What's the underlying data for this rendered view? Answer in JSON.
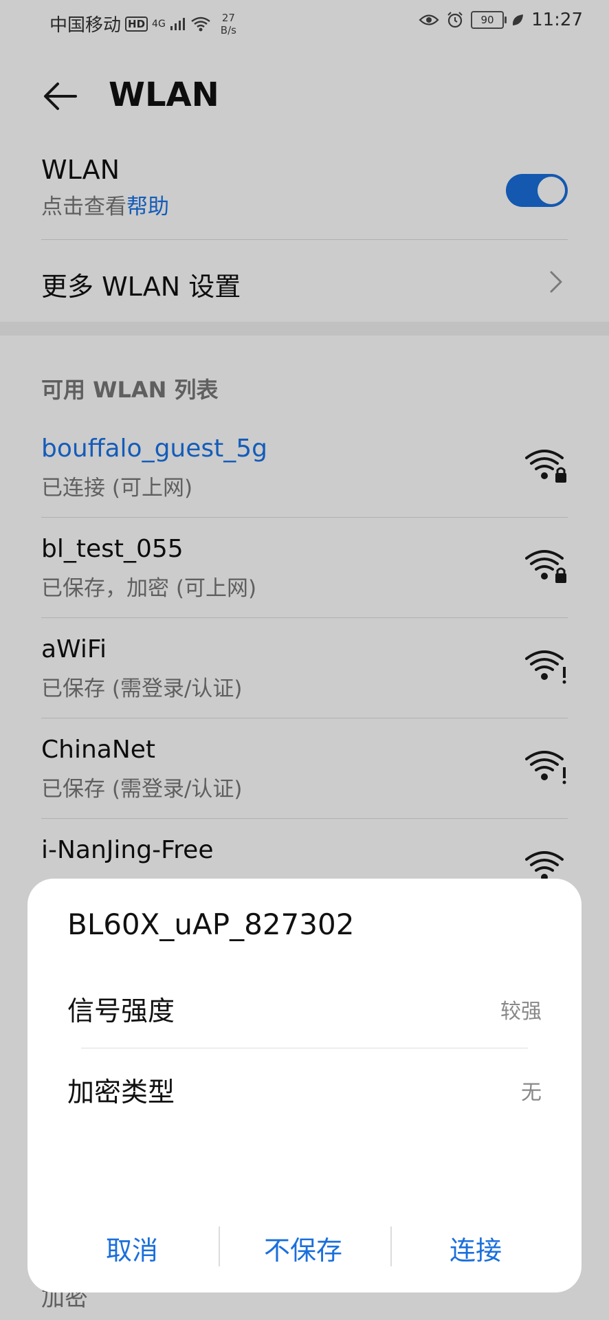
{
  "status_bar": {
    "carrier": "中国移动",
    "hd": "HD",
    "network": "4G",
    "speed_value": "27",
    "speed_unit": "B/s",
    "battery": "90",
    "time": "11:27"
  },
  "header": {
    "title": "WLAN"
  },
  "wlan_toggle": {
    "title": "WLAN",
    "subtitle_prefix": "点击查看",
    "help_link": "帮助",
    "enabled": true
  },
  "more_settings": {
    "label": "更多 WLAN 设置"
  },
  "available_section": {
    "title": "可用 WLAN 列表"
  },
  "networks": [
    {
      "name": "bouffalo_guest_5g",
      "status": "已连接 (可上网)",
      "icon": "wifi-lock-icon",
      "connected": true
    },
    {
      "name": "bl_test_055",
      "status": "已保存，加密 (可上网)",
      "icon": "wifi-lock-icon",
      "connected": false
    },
    {
      "name": "aWiFi",
      "status": "已保存 (需登录/认证)",
      "icon": "wifi-alert-icon",
      "connected": false
    },
    {
      "name": "ChinaNet",
      "status": "已保存 (需登录/认证)",
      "icon": "wifi-alert-icon",
      "connected": false
    },
    {
      "name": "i-NanJing-Free",
      "status": "",
      "icon": "wifi-alert-icon",
      "connected": false
    }
  ],
  "bottom_peek": "加密",
  "dialog": {
    "title": "BL60X_uAP_827302",
    "rows": [
      {
        "label": "信号强度",
        "value": "较强"
      },
      {
        "label": "加密类型",
        "value": "无"
      }
    ],
    "actions": {
      "cancel": "取消",
      "forget": "不保存",
      "connect": "连接"
    }
  },
  "colors": {
    "accent": "#1a6fdc",
    "link": "#1a73e8"
  }
}
